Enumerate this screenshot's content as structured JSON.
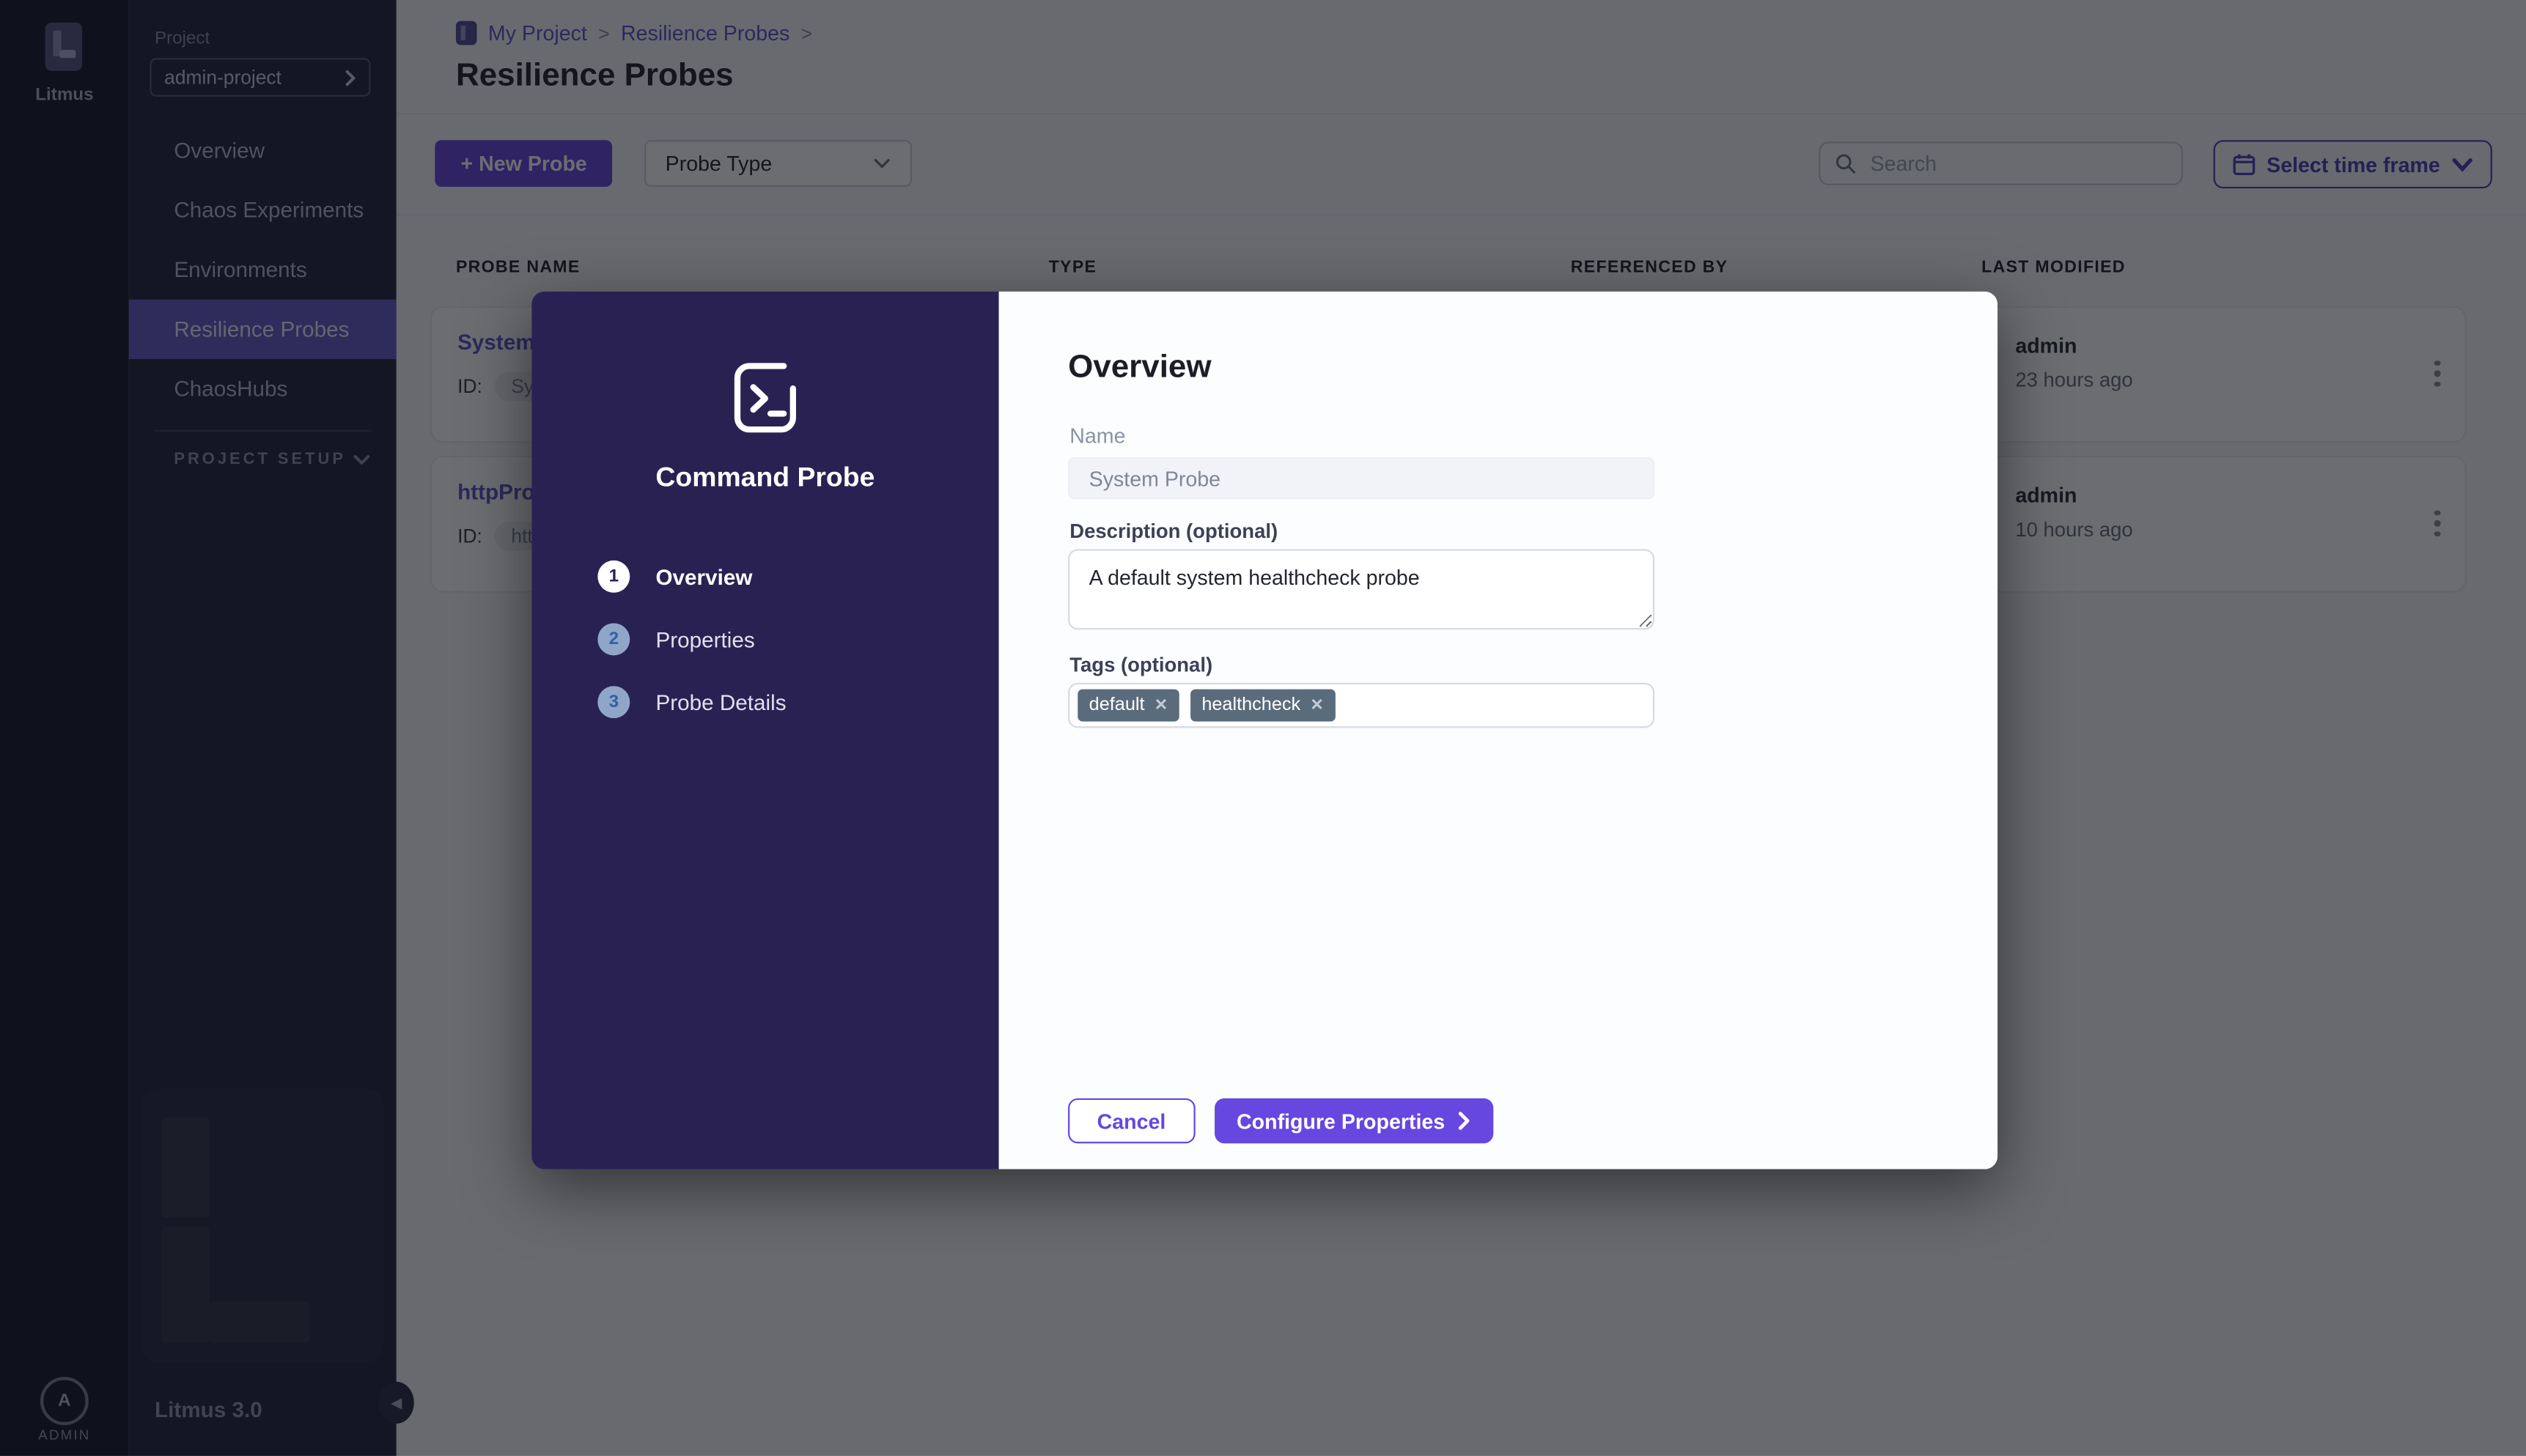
{
  "app": {
    "brand": "Litmus",
    "version_label": "Litmus 3.0",
    "user_initial": "A",
    "user_label": "ADMIN"
  },
  "sidebar": {
    "project_label": "Project",
    "project_selector": "admin-project",
    "items": [
      {
        "label": "Overview"
      },
      {
        "label": "Chaos Experiments"
      },
      {
        "label": "Environments"
      },
      {
        "label": "Resilience Probes"
      },
      {
        "label": "ChaosHubs"
      }
    ],
    "active_item": "Resilience Probes",
    "section_label": "PROJECT SETUP"
  },
  "header": {
    "breadcrumb": [
      "My Project",
      "Resilience Probes"
    ],
    "separator": ">",
    "title": "Resilience Probes"
  },
  "toolbar": {
    "new_probe_label": "+ New Probe",
    "probe_type_label": "Probe Type",
    "search_placeholder": "Search",
    "time_frame_label": "Select time frame"
  },
  "table": {
    "columns": [
      "PROBE NAME",
      "TYPE",
      "REFERENCED BY",
      "LAST MODIFIED"
    ],
    "rows": [
      {
        "name": "System",
        "id_label": "ID:",
        "id_value": "Syst",
        "owner": "admin",
        "modified": "23 hours ago"
      },
      {
        "name": "httpPro",
        "id_label": "ID:",
        "id_value": "http",
        "owner": "admin",
        "modified": "10 hours ago"
      }
    ]
  },
  "modal": {
    "probe_type_title": "Command Probe",
    "steps": [
      {
        "number": "1",
        "label": "Overview",
        "state": "current"
      },
      {
        "number": "2",
        "label": "Properties",
        "state": "todo"
      },
      {
        "number": "3",
        "label": "Probe Details",
        "state": "todo"
      }
    ],
    "title": "Overview",
    "name_label": "Name",
    "name_value": "System Probe",
    "description_label": "Description (optional)",
    "description_value": "A default system healthcheck probe",
    "tags_label": "Tags (optional)",
    "tags": [
      {
        "label": "default"
      },
      {
        "label": "healthcheck"
      }
    ],
    "cancel_label": "Cancel",
    "submit_label": "Configure Properties"
  },
  "colors": {
    "accent": "#6647df",
    "modal_panel": "#2a2153",
    "tag_chip": "#5a6b7c",
    "active_nav": "#655cc9"
  }
}
